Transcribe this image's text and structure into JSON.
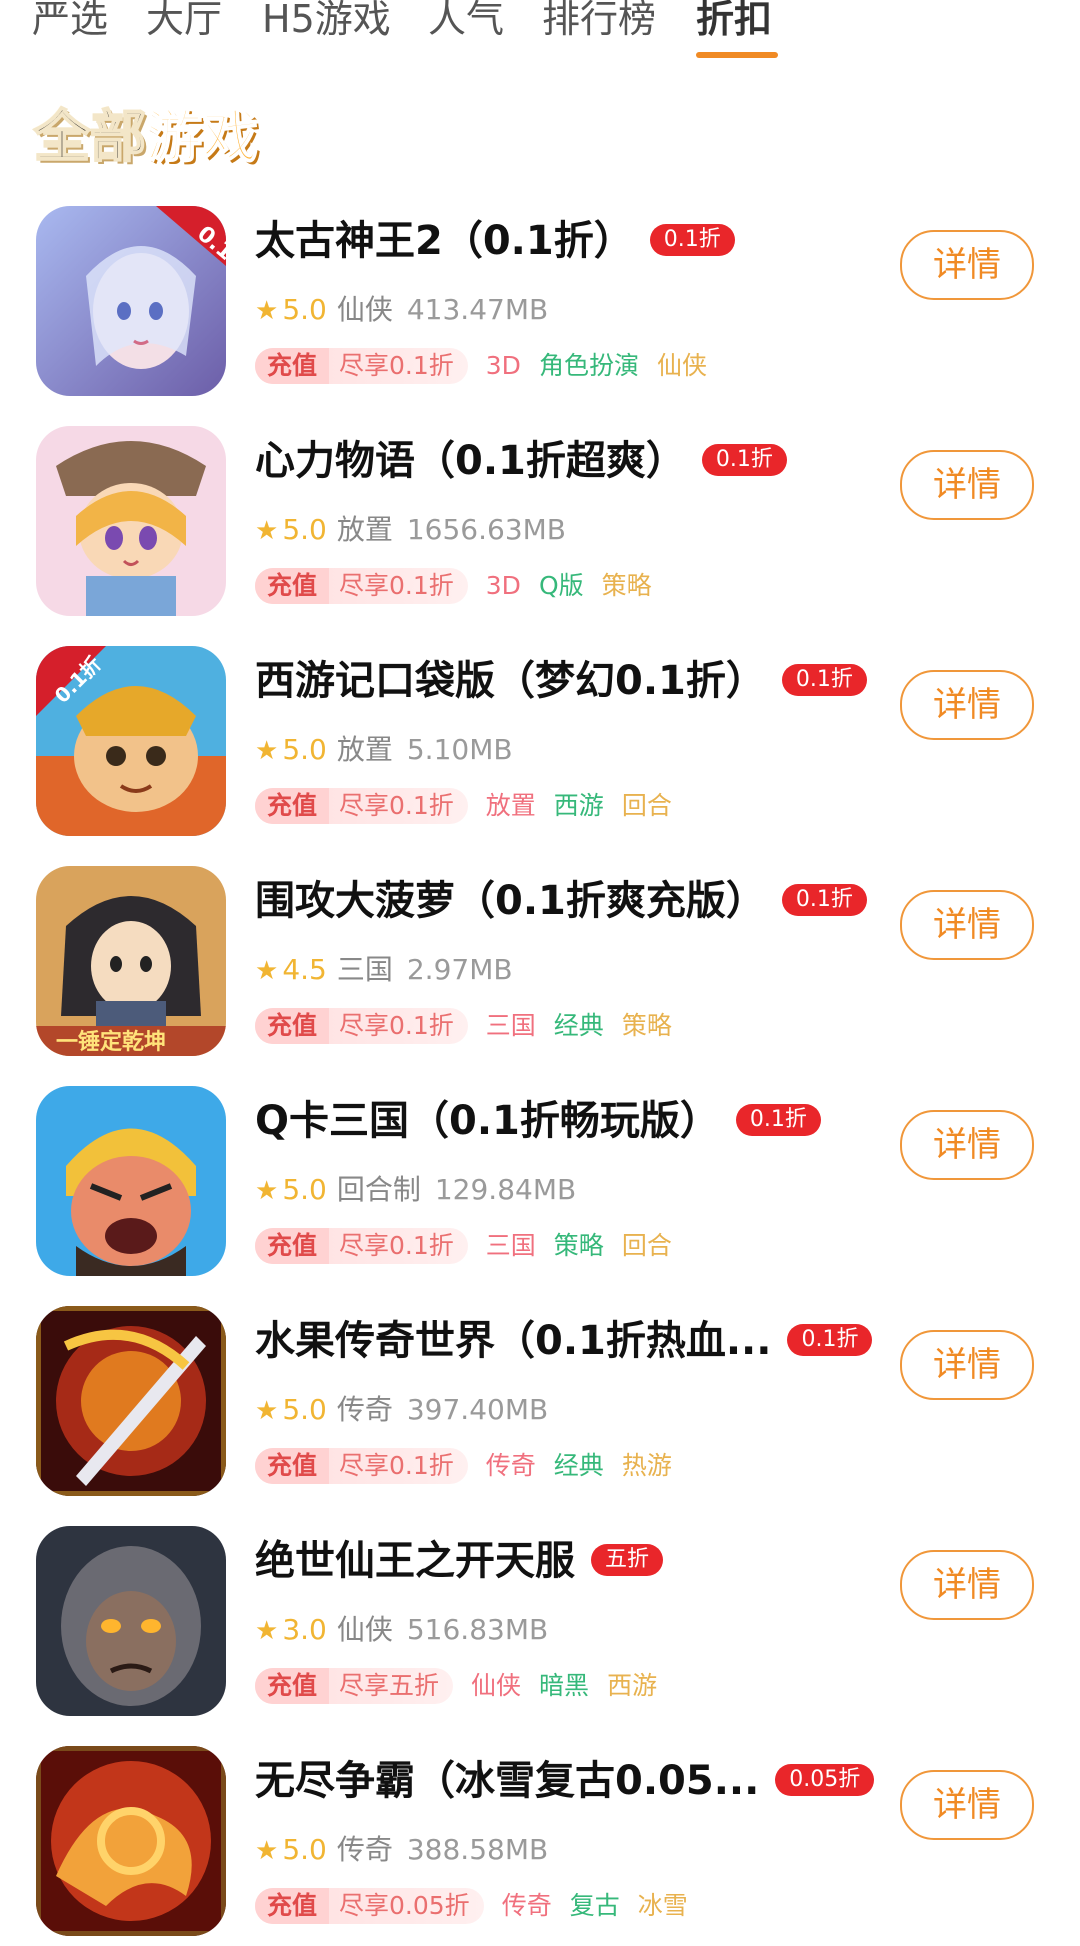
{
  "tabs": [
    {
      "label": "严选"
    },
    {
      "label": "大厅"
    },
    {
      "label": "H5游戏"
    },
    {
      "label": "人气"
    },
    {
      "label": "排行榜"
    },
    {
      "label": "折扣",
      "active": true
    }
  ],
  "section": {
    "title_part1": "全部",
    "title_part2": "游戏"
  },
  "games": [
    {
      "title": "太古神王2（0.1折）",
      "badge": "0.1折",
      "rating": "5.0",
      "category": "仙侠",
      "size": "413.47MB",
      "recharge_label": "充值",
      "recharge_text": "尽享0.1折",
      "tags": [
        "3D",
        "角色扮演",
        "仙侠"
      ],
      "detail_label": "详情",
      "icon": "fairy-game-icon"
    },
    {
      "title": "心力物语（0.1折超爽）",
      "badge": "0.1折",
      "rating": "5.0",
      "category": "放置",
      "size": "1656.63MB",
      "recharge_label": "充值",
      "recharge_text": "尽享0.1折",
      "tags": [
        "3D",
        "Q版",
        "策略"
      ],
      "detail_label": "详情",
      "icon": "anime-girl-game-icon"
    },
    {
      "title": "西游记口袋版（梦幻0.1折）",
      "badge": "0.1折",
      "rating": "5.0",
      "category": "放置",
      "size": "5.10MB",
      "recharge_label": "充值",
      "recharge_text": "尽享0.1折",
      "tags": [
        "放置",
        "西游",
        "回合"
      ],
      "detail_label": "详情",
      "icon": "monkey-king-game-icon"
    },
    {
      "title": "围攻大菠萝（0.1折爽充版）",
      "badge": "0.1折",
      "rating": "4.5",
      "category": "三国",
      "size": "2.97MB",
      "recharge_label": "充值",
      "recharge_text": "尽享0.1折",
      "tags": [
        "三国",
        "经典",
        "策略"
      ],
      "detail_label": "详情",
      "icon": "warrior-game-icon"
    },
    {
      "title": "Q卡三国（0.1折畅玩版）",
      "badge": "0.1折",
      "rating": "5.0",
      "category": "回合制",
      "size": "129.84MB",
      "recharge_label": "充值",
      "recharge_text": "尽享0.1折",
      "tags": [
        "三国",
        "策略",
        "回合"
      ],
      "detail_label": "详情",
      "icon": "angry-general-game-icon"
    },
    {
      "title": "水果传奇世界（0.1折热血...",
      "badge": "0.1折",
      "rating": "5.0",
      "category": "传奇",
      "size": "397.40MB",
      "recharge_label": "充值",
      "recharge_text": "尽享0.1折",
      "tags": [
        "传奇",
        "经典",
        "热游"
      ],
      "detail_label": "详情",
      "icon": "dragon-sword-game-icon"
    },
    {
      "title": "绝世仙王之开天服",
      "badge": "五折",
      "rating": "3.0",
      "category": "仙侠",
      "size": "516.83MB",
      "recharge_label": "充值",
      "recharge_text": "尽享五折",
      "tags": [
        "仙侠",
        "暗黑",
        "西游"
      ],
      "detail_label": "详情",
      "icon": "ape-warrior-game-icon"
    },
    {
      "title": "无尽争霸（冰雪复古0.05...",
      "badge": "0.05折",
      "rating": "5.0",
      "category": "传奇",
      "size": "388.58MB",
      "recharge_label": "充值",
      "recharge_text": "尽享0.05折",
      "tags": [
        "传奇",
        "复古",
        "冰雪"
      ],
      "detail_label": "详情",
      "icon": "fire-dragon-game-icon"
    }
  ]
}
